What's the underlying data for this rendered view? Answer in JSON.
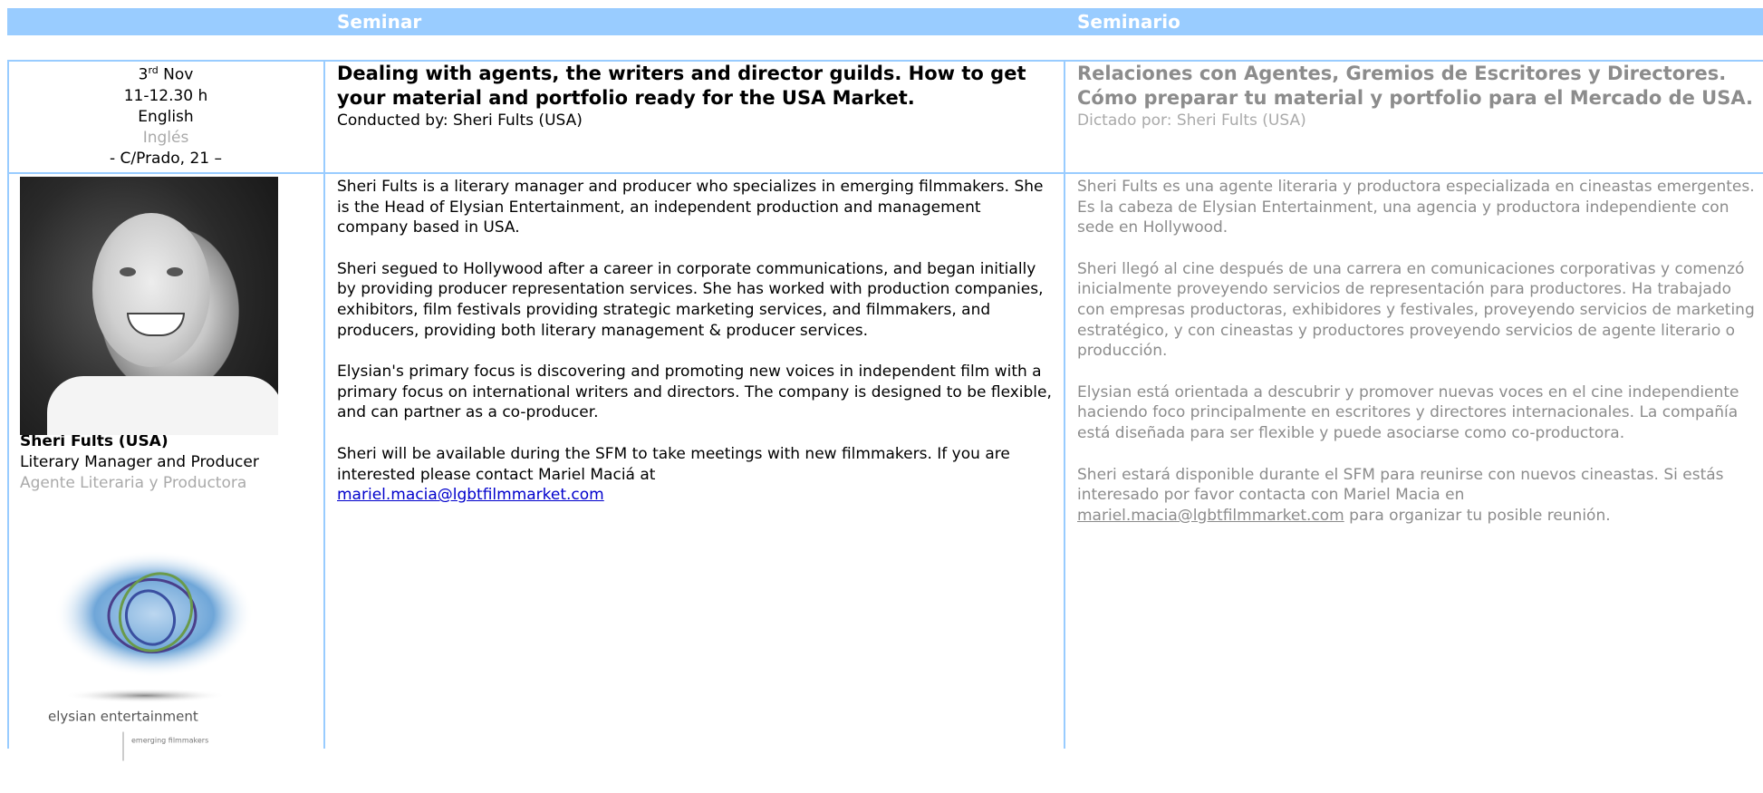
{
  "header": {
    "col_en": "Seminar",
    "col_es": "Seminario"
  },
  "session": {
    "date_day": "3",
    "date_sup": "rd",
    "date_month": "Nov",
    "time": "11-12.30 h",
    "language": "English",
    "language_es": "Inglés",
    "venue": "- C/Prado, 21 –"
  },
  "title_en": "Dealing with agents, the writers and director guilds. How to get your material and portfolio ready for the USA Market.",
  "conducted_en": "Conducted by: Sheri Fults (USA)",
  "title_es": "Relaciones con Agentes, Gremios de Escritores y Directores. Cómo preparar tu material y portfolio para el Mercado de USA.",
  "conducted_es": "Dictado por: Sheri Fults (USA)",
  "speaker": {
    "name": "Sheri Fults (USA)",
    "role_en": "Literary Manager and Producer",
    "role_es": "Agente Literaria y Productora"
  },
  "logo": {
    "company": "elysian entertainment",
    "tagline": "emerging filmmakers"
  },
  "bio_en": {
    "p1": "Sheri Fults is a literary manager and producer who specializes in emerging filmmakers.  She is the Head of Elysian Entertainment, an independent production and management company based in USA.",
    "p2": "Sheri segued to Hollywood after a career in corporate communications, and began initially by providing producer representation services. She has worked with production companies, exhibitors, film festivals providing strategic marketing services, and filmmakers, and producers, providing both literary management & producer services.",
    "p3": "Elysian's primary focus is discovering and promoting new voices in independent film with a primary focus on international writers and directors.  The company is designed to be flexible, and can partner as a co-producer.",
    "p4": "Sheri will be available during the SFM to take meetings with new filmmakers.  If you are interested please contact Mariel Maciá at",
    "email": "mariel.macia@lgbtfilmmarket.com"
  },
  "bio_es": {
    "p1": "Sheri Fults es una agente literaria y productora especializada en cineastas emergentes.  Es la cabeza de Elysian Entertainment, una agencia y productora independiente con sede en Hollywood.",
    "p2": "Sheri llegó al cine después de una carrera en comunicaciones corporativas y comenzó inicialmente proveyendo servicios de representación para productores. Ha trabajado con empresas productoras, exhibidores y festivales, proveyendo servicios de marketing estratégico, y con cineastas y productores proveyendo servicios de agente literario o producción.",
    "p3": "Elysian está orientada a descubrir y promover nuevas voces en el cine independiente haciendo foco principalmente en escritores y directores internacionales.  La compañía está diseñada para ser flexible y puede asociarse como co-productora.",
    "p4": "Sheri estará disponible durante el SFM para reunirse con nuevos cineastas.  Si estás interesado por favor contacta con Mariel Macia en",
    "email": "mariel.macia@lgbtfilmmarket.com",
    "p4_tail": " para organizar tu posible reunión."
  },
  "colors": {
    "header_bg": "#99ccff",
    "border": "#99ccff",
    "grey_text": "#8c8c8c",
    "link": "#0000cc"
  }
}
